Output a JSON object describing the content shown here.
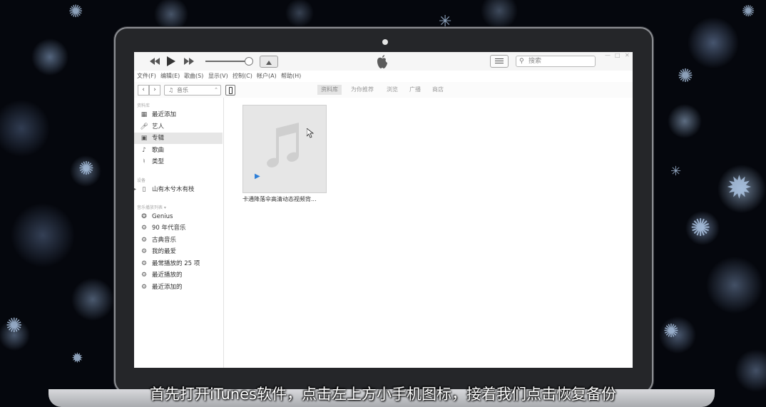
{
  "toolbar": {
    "prev_icon": "rewind-icon",
    "play_icon": "play-icon",
    "next_icon": "fast-forward-icon",
    "search_placeholder": "搜索",
    "search_icon": "search-icon"
  },
  "menu": [
    "文件(F)",
    "编辑(E)",
    "歌曲(S)",
    "显示(V)",
    "控制(C)",
    "帐户(A)",
    "帮助(H)"
  ],
  "nav": {
    "media": "音乐",
    "tabs": [
      "资料库",
      "为你推荐",
      "浏览",
      "广播",
      "商店"
    ],
    "active_tab": "资料库"
  },
  "sidebar": {
    "library_header": "资料库",
    "library_items": [
      {
        "label": "最近添加",
        "icon": "grid-icon"
      },
      {
        "label": "艺人",
        "icon": "microphone-icon"
      },
      {
        "label": "专辑",
        "icon": "album-icon",
        "selected": true
      },
      {
        "label": "歌曲",
        "icon": "music-note-icon"
      },
      {
        "label": "类型",
        "icon": "genre-icon"
      }
    ],
    "devices_header": "设备",
    "device_name": "山有木兮木有枝",
    "playlists_header": "音乐播放列表 ▾",
    "playlists": [
      {
        "label": "Genius",
        "icon": "genius-icon"
      },
      {
        "label": "90 年代音乐",
        "icon": "gear-icon"
      },
      {
        "label": "古典音乐",
        "icon": "gear-icon"
      },
      {
        "label": "我的最爱",
        "icon": "gear-icon"
      },
      {
        "label": "最常播放的 25 项",
        "icon": "gear-icon"
      },
      {
        "label": "最近播放的",
        "icon": "gear-icon"
      },
      {
        "label": "最近添加的",
        "icon": "gear-icon"
      }
    ]
  },
  "content": {
    "album_title": "卡通降落伞高清动态视频背..."
  },
  "subtitle": "首先打开iTunes软件，点击左上方小手机图标，接着我们点击恢复备份"
}
